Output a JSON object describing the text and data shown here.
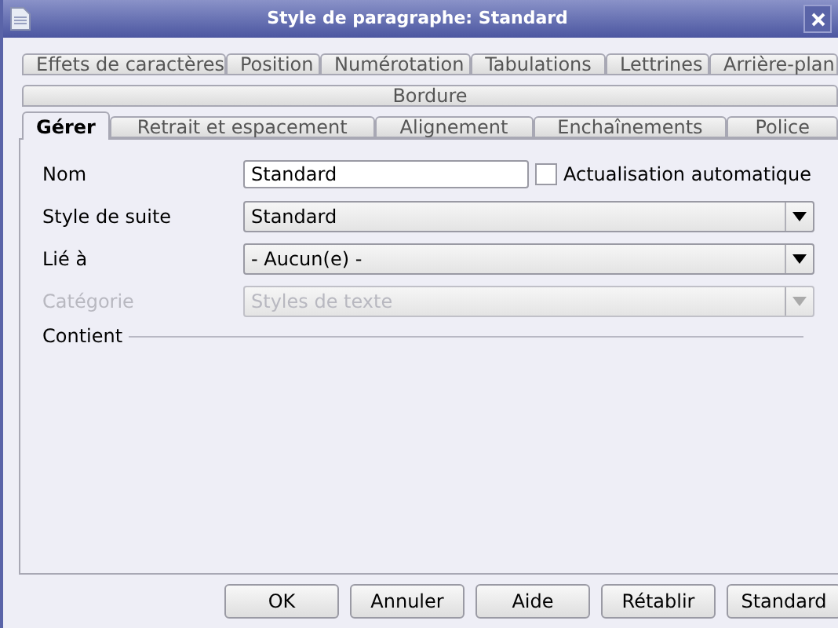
{
  "window": {
    "title": "Style de paragraphe: Standard"
  },
  "tab_rows": [
    [
      {
        "label": "Effets de caractères",
        "selected": false
      },
      {
        "label": "Position",
        "selected": false
      },
      {
        "label": "Numérotation",
        "selected": false
      },
      {
        "label": "Tabulations",
        "selected": false
      },
      {
        "label": "Lettrines",
        "selected": false
      },
      {
        "label": "Arrière-plan",
        "selected": false
      }
    ],
    [
      {
        "label": "Bordure",
        "selected": false
      }
    ],
    [
      {
        "label": "Gérer",
        "selected": true
      },
      {
        "label": "Retrait et espacement",
        "selected": false
      },
      {
        "label": "Alignement",
        "selected": false
      },
      {
        "label": "Enchaînements",
        "selected": false
      },
      {
        "label": "Police",
        "selected": false
      }
    ]
  ],
  "form": [
    {
      "kind": "text",
      "label": "Nom",
      "value": "Standard",
      "disabled": false,
      "checkbox": {
        "label": "Actualisation automatique",
        "checked": false
      }
    },
    {
      "kind": "combo",
      "label": "Style de suite",
      "value": "Standard",
      "disabled": false
    },
    {
      "kind": "combo",
      "label": "Lié à",
      "value": "- Aucun(e) -",
      "disabled": false
    },
    {
      "kind": "combo",
      "label": "Catégorie",
      "value": "Styles de texte",
      "disabled": true
    }
  ],
  "contains": {
    "label": "Contient"
  },
  "buttons": [
    "OK",
    "Annuler",
    "Aide",
    "Rétablir",
    "Standard"
  ]
}
